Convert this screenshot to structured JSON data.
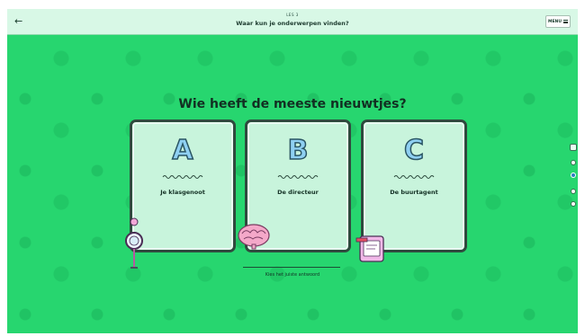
{
  "topbar": {
    "lesson_label": "LES 3",
    "title": "Waar kun je onderwerpen vinden?",
    "back_icon": "arrow-left-icon",
    "menu_label": "MENU",
    "menu_icon": "hamburger-icon"
  },
  "question": "Wie heeft de meeste nieuwtjes?",
  "options": [
    {
      "letter": "A",
      "answer": "Je klasgenoot"
    },
    {
      "letter": "B",
      "answer": "De directeur"
    },
    {
      "letter": "C",
      "answer": "De buurtagent"
    }
  ],
  "hint": "Kies het juiste antwoord",
  "colors": {
    "background": "#27d66f",
    "card": "#c8f4dc",
    "letter": "#8fd0f2",
    "topbar": "#d8f8e6"
  },
  "illustrations": [
    "magnifying-glass-icon",
    "brain-icon",
    "tablet-icon"
  ]
}
